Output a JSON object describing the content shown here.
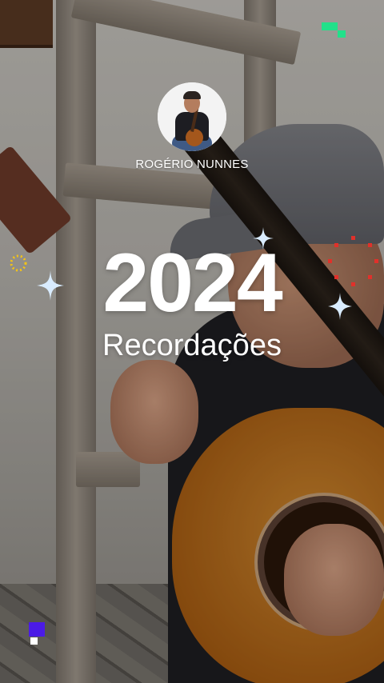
{
  "artist": {
    "name": "ROGÉRIO NUNNES"
  },
  "hero": {
    "year": "2024",
    "subtitle": "Recordações"
  },
  "colors": {
    "text": "#ffffff",
    "sparkle": "#d9ecff",
    "accent_green": "#22e08a",
    "accent_purple": "#4b1be6",
    "accent_red": "#e0312b",
    "accent_yellow": "#f2c318"
  },
  "icons": {
    "sparkles": "four-point-star",
    "top_right": "pixel-squares",
    "bottom_left": "pixel-squares",
    "left_ring": "dotted-circle",
    "right_ring": "dotted-circle"
  }
}
